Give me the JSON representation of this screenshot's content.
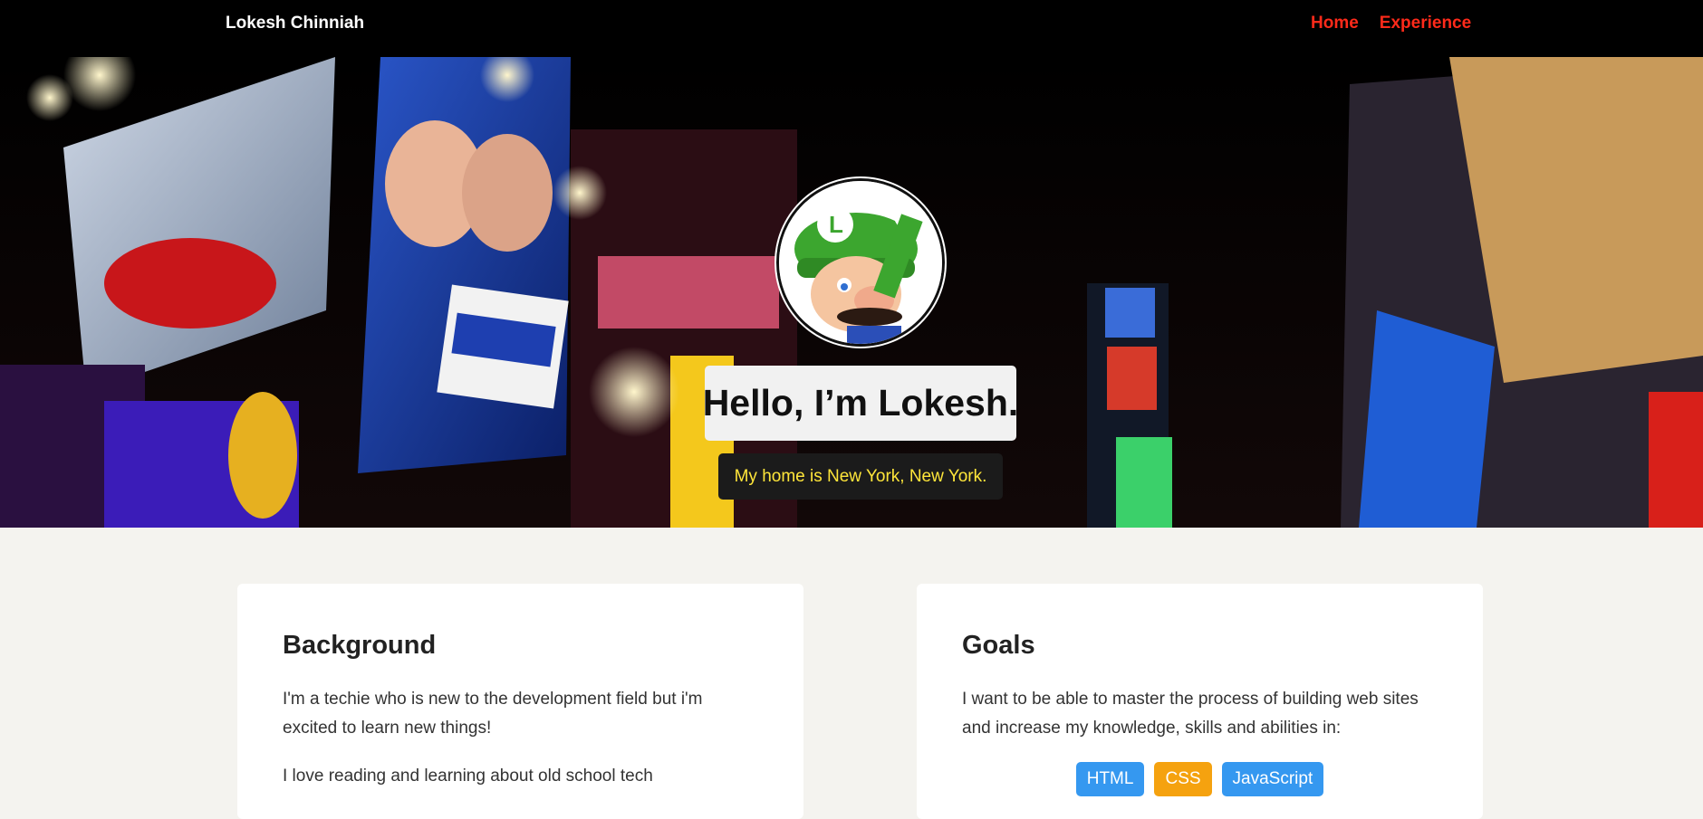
{
  "nav": {
    "brand": "Lokesh Chinniah",
    "links": [
      "Home",
      "Experience"
    ],
    "link_color": "#ff2a1a"
  },
  "hero": {
    "headline": "Hello, I’m Lokesh.",
    "tagline": "My home is New York, New York.",
    "background": "times-square-photo",
    "avatar": "luigi-avatar"
  },
  "cards": {
    "background": {
      "title": "Background",
      "paragraphs": [
        "I'm a techie who is new to the development field but i'm excited to learn new things!",
        "I love reading and learning about old school tech"
      ]
    },
    "goals": {
      "title": "Goals",
      "text": "I want to be able to master the process of building web sites and increase my knowledge, skills and abilities in:",
      "skills": [
        {
          "label": "HTML",
          "color": "#3598f0"
        },
        {
          "label": "CSS",
          "color": "#f5a20f"
        },
        {
          "label": "JavaScript",
          "color": "#3598f0"
        }
      ]
    }
  }
}
